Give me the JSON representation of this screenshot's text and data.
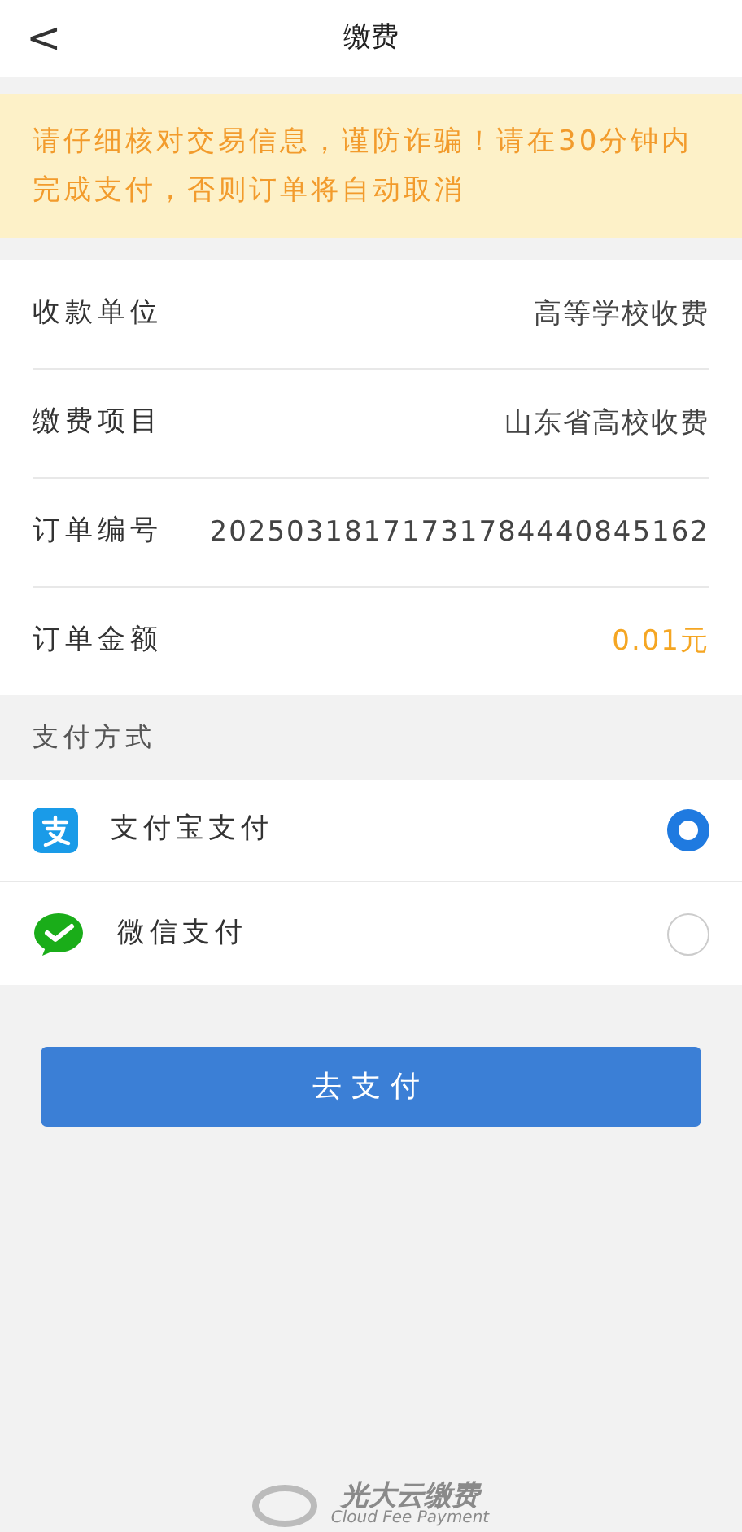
{
  "header": {
    "back": "<",
    "title": "缴费"
  },
  "notice": "请仔细核对交易信息，谨防诈骗！请在30分钟内完成支付，否则订单将自动取消",
  "details": [
    {
      "label": "收款单位",
      "value": "高等学校收费",
      "kind": "plain"
    },
    {
      "label": "缴费项目",
      "value": "山东省高校收费",
      "kind": "plain"
    },
    {
      "label": "订单编号",
      "value": "20250318171731784440845162",
      "kind": "plain"
    },
    {
      "label": "订单金额",
      "value": "0.01元",
      "kind": "amount"
    }
  ],
  "payment_section": "支付方式",
  "payment_methods": [
    {
      "name": "支付宝支付",
      "kind": "alipay",
      "selected": true
    },
    {
      "name": "微信支付",
      "kind": "wechat",
      "selected": false
    }
  ],
  "pay_button": "去支付",
  "footer": {
    "brand": "光大云缴费",
    "tagline": "Cloud Fee Payment"
  }
}
